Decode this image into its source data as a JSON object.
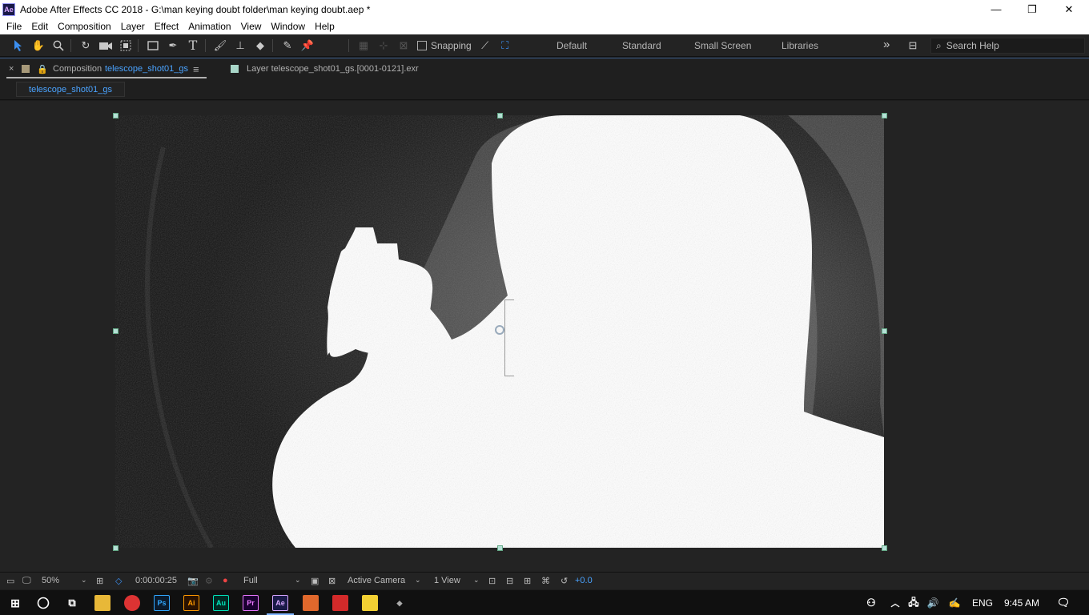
{
  "window": {
    "logo": "Ae",
    "title": "Adobe After Effects CC 2018 - G:\\man keying doubt folder\\man keying doubt.aep *",
    "minimize": "—",
    "maximize": "❐",
    "close": "✕"
  },
  "menu": [
    "File",
    "Edit",
    "Composition",
    "Layer",
    "Effect",
    "Animation",
    "View",
    "Window",
    "Help"
  ],
  "toolbar": {
    "snapping_label": "Snapping",
    "workspaces": [
      "Default",
      "Standard",
      "Small Screen",
      "Libraries"
    ],
    "overflow": "»",
    "search_placeholder": "Search Help"
  },
  "panel": {
    "close": "×",
    "comp_prefix": "Composition",
    "comp_name": "telescope_shot01_gs",
    "menu_icon": "≡",
    "layer_label": "Layer  telescope_shot01_gs.[0001-0121].exr",
    "subtab": "telescope_shot01_gs"
  },
  "status": {
    "zoom": "50%",
    "timecode": "0:00:00:25",
    "resolution": "Full",
    "camera": "Active Camera",
    "views": "1 View",
    "exposure": "+0.0"
  },
  "taskbar": {
    "language": "ENG",
    "time": "9:45 AM",
    "apps": [
      "Ps",
      "Ai",
      "Au",
      "Pr",
      "Ae"
    ]
  },
  "colors": {
    "accent": "#3c8ff0",
    "link": "#4aa3ff",
    "handle": "#b5e0d6"
  }
}
